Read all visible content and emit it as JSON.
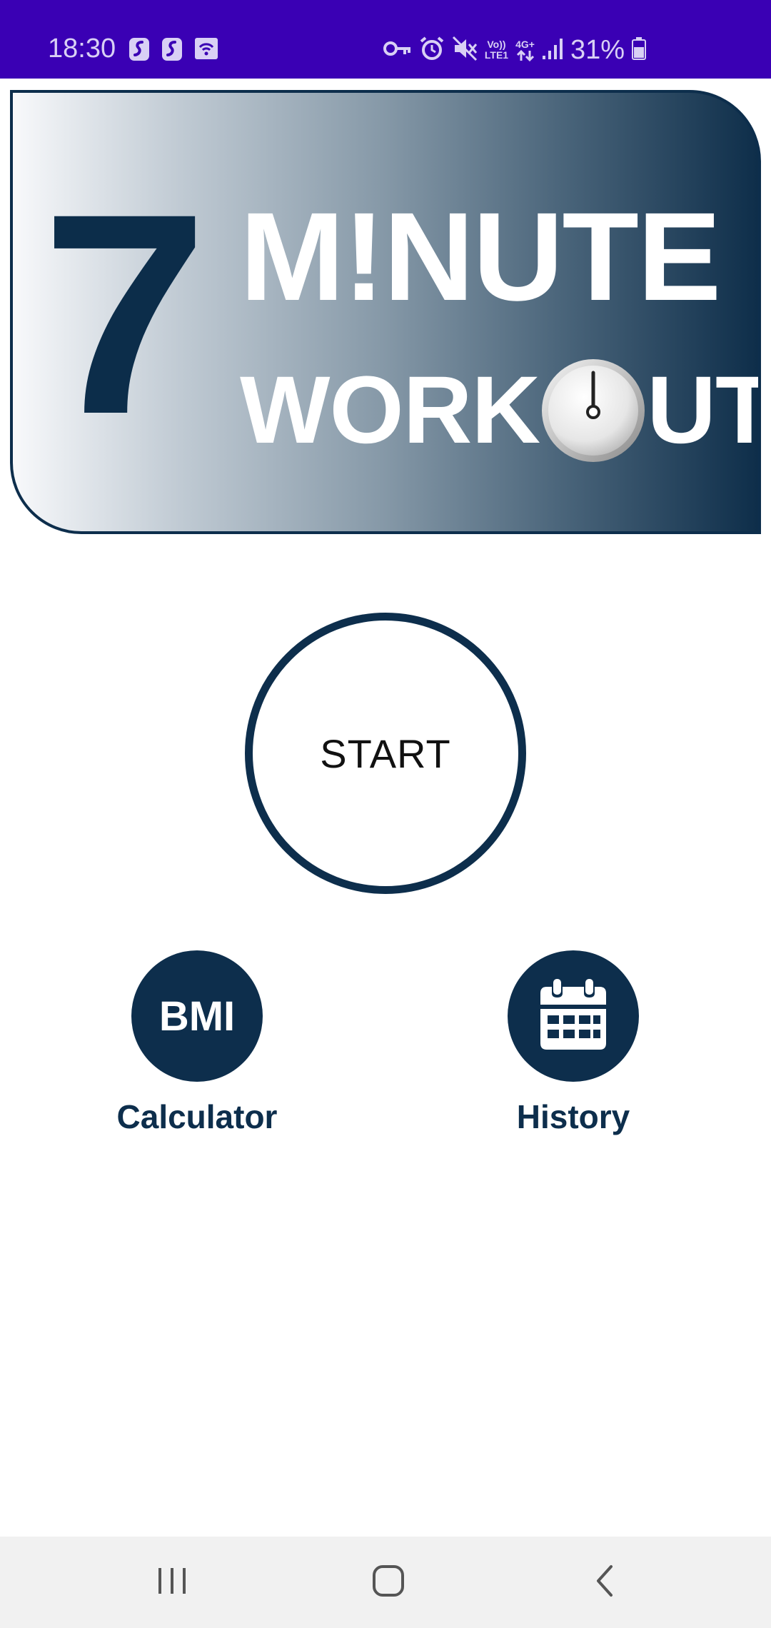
{
  "status_bar": {
    "time": "18:30",
    "battery_percent": "31%",
    "network_top": "Vo))",
    "network_bottom": "LTE1",
    "data_type": "4G+",
    "background_color": "#3a00b4",
    "icons": [
      "app-notification-icon",
      "app-notification-icon",
      "screen-cast-icon",
      "vpn-key-icon",
      "alarm-icon",
      "mute-icon",
      "volte-icon",
      "data-arrows-icon",
      "signal-icon",
      "battery-icon"
    ]
  },
  "banner": {
    "number": "7",
    "line1": "M!NUTE",
    "line2_before": "WORK",
    "line2_after": "UT",
    "gradient_start": "#f8f9fb",
    "gradient_end": "#0e2e4a",
    "icon": "stopwatch-icon"
  },
  "main": {
    "start_label": "START",
    "bmi_button_text": "BMI",
    "bmi_label": "Calculator",
    "history_label": "History",
    "history_icon": "calendar-icon",
    "accent_color": "#0d2e4c"
  },
  "nav_bar": {
    "items": [
      "recent-apps-icon",
      "home-icon",
      "back-icon"
    ]
  }
}
